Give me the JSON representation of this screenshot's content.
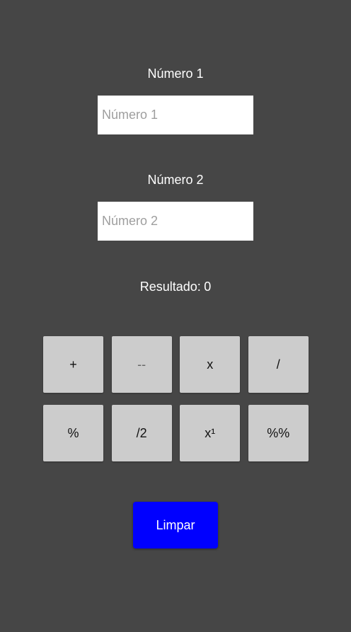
{
  "number1": {
    "label": "Número 1",
    "placeholder": "Número 1",
    "value": ""
  },
  "number2": {
    "label": "Número 2",
    "placeholder": "Número 2",
    "value": ""
  },
  "result": {
    "label": "Resultado:",
    "value": "0"
  },
  "operations": [
    {
      "label": "+"
    },
    {
      "label": "--"
    },
    {
      "label": "x"
    },
    {
      "label": "/"
    },
    {
      "label": "%"
    },
    {
      "label": "/2"
    },
    {
      "label": "x¹"
    },
    {
      "label": "%%"
    }
  ],
  "clear": {
    "label": "Limpar"
  },
  "colors": {
    "background": "#464646",
    "field_background": "#ffffff",
    "operation_button": "#cccccc",
    "clear_button": "#0000ff"
  }
}
